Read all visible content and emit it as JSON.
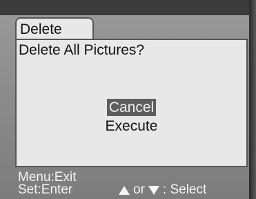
{
  "dialog": {
    "tab_label": "Delete",
    "question": "Delete All Pictures?",
    "options": [
      {
        "label": "Cancel",
        "selected": true
      },
      {
        "label": "Execute",
        "selected": false
      }
    ]
  },
  "footer": {
    "menu_hint": "Menu:Exit",
    "set_hint": "Set:Enter",
    "or_text": "or",
    "select_text": ": Select",
    "up_icon": "triangle-up-icon",
    "down_icon": "triangle-down-icon"
  },
  "colors": {
    "panel_bg": "#e8e8e8",
    "highlight_bg": "#5e5e5e",
    "footer_text": "#f4f4f4"
  }
}
